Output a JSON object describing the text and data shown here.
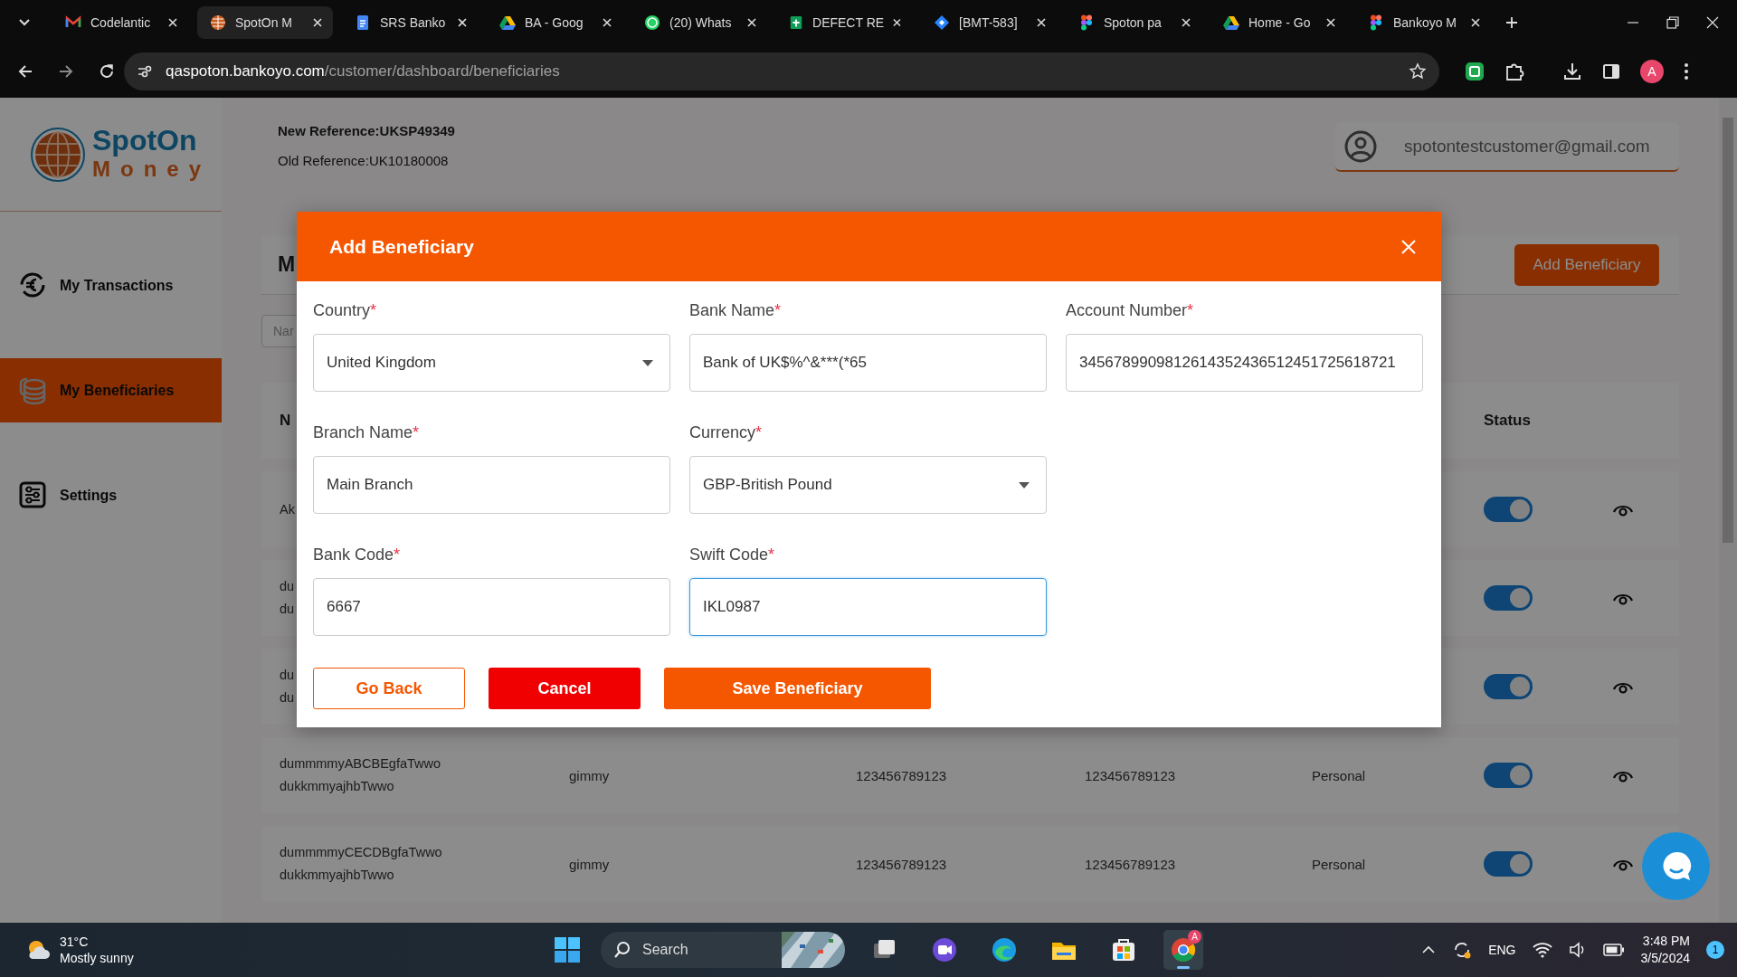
{
  "browser": {
    "tabs": [
      {
        "title": "Codelantic",
        "selected": false
      },
      {
        "title": "SpotOn M",
        "selected": true
      },
      {
        "title": "SRS Banko",
        "selected": false
      },
      {
        "title": "BA - Goog",
        "selected": false
      },
      {
        "title": "(20) Whats",
        "selected": false
      },
      {
        "title": "DEFECT RE",
        "selected": false
      },
      {
        "title": "[BMT-583]",
        "selected": false
      },
      {
        "title": "Spoton pa",
        "selected": false
      },
      {
        "title": "Home - Go",
        "selected": false
      },
      {
        "title": "Bankoyo M",
        "selected": false
      }
    ],
    "url_host": "qaspoton.bankoyo.com",
    "url_path": "/customer/dashboard/beneficiaries",
    "profile": "A"
  },
  "sidebar": {
    "logo": {
      "line1": "SpotOn",
      "line2": "Money"
    },
    "items": [
      {
        "label": "My Transactions",
        "selected": false
      },
      {
        "label": "My Beneficiaries",
        "selected": true
      },
      {
        "label": "Settings",
        "selected": false
      }
    ]
  },
  "header": {
    "new_reference": "New Reference:UKSP49349",
    "old_reference": "Old Reference:UK10180008",
    "user_email": "spotontestcustomer@gmail.com"
  },
  "beneficiaries_card": {
    "title": "M",
    "add_button": "Add Beneficiary",
    "search": {
      "placeholder": "Nar"
    },
    "table": {
      "name_column": "N",
      "status_column": "Status",
      "rows": [
        {
          "name_lines": [
            "Ak"
          ],
          "status_on": true
        },
        {
          "name_lines": [
            "du",
            "du"
          ],
          "status_on": true
        },
        {
          "name_lines": [
            "du",
            "du"
          ],
          "status_on": true
        },
        {
          "name_lines": [
            "dummmmyABCBEgfaTwwo",
            "dukkmmyajhbTwwo"
          ],
          "cells": [
            "gimmy",
            "123456789123",
            "123456789123",
            "Personal"
          ],
          "status_on": true
        },
        {
          "name_lines": [
            "dummmmyCECDBgfaTwwo",
            "dukkmmyajhbTwwo"
          ],
          "cells": [
            "gimmy",
            "123456789123",
            "123456789123",
            "Personal"
          ],
          "status_on": true
        }
      ]
    }
  },
  "modal": {
    "title": "Add Beneficiary",
    "field_rows": [
      [
        {
          "label": "Country",
          "required_mark": "*",
          "value": "United Kingdom",
          "kind": "select",
          "focused": false
        },
        {
          "label": "Bank Name",
          "required_mark": "*",
          "value": "Bank of UK$%^&***(*65",
          "kind": "text",
          "focused": false
        },
        {
          "label": "Account Number",
          "required_mark": "*",
          "value": "3456789909812614352436512451725618721",
          "kind": "text",
          "focused": false
        }
      ],
      [
        {
          "label": "Branch Name",
          "required_mark": "*",
          "value": "Main Branch",
          "kind": "text",
          "focused": false
        },
        {
          "label": "Currency",
          "required_mark": "*",
          "value": "GBP-British Pound",
          "kind": "select",
          "focused": false
        }
      ],
      [
        {
          "label": "Bank Code",
          "required_mark": "*",
          "value": "6667",
          "kind": "text",
          "focused": false
        },
        {
          "label": "Swift Code",
          "required_mark": "*",
          "value": "IKL0987",
          "kind": "text",
          "focused": true
        }
      ]
    ],
    "buttons": [
      {
        "label": "Go Back",
        "kind": "outline"
      },
      {
        "label": "Cancel",
        "kind": "danger"
      },
      {
        "label": "Save Beneficiary",
        "kind": "primary"
      }
    ]
  },
  "taskbar": {
    "weather": {
      "temp": "31°C",
      "condition": "Mostly sunny"
    },
    "search": {
      "placeholder": "Search"
    },
    "apps": [
      {
        "running": false
      },
      {
        "running": false
      },
      {
        "running": false
      },
      {
        "running": false
      },
      {
        "running": false
      },
      {
        "running": true,
        "badge": "A"
      }
    ],
    "tray": {
      "language": "ENG",
      "time": "3:48 PM",
      "date": "3/5/2024",
      "notifications": "1"
    }
  }
}
